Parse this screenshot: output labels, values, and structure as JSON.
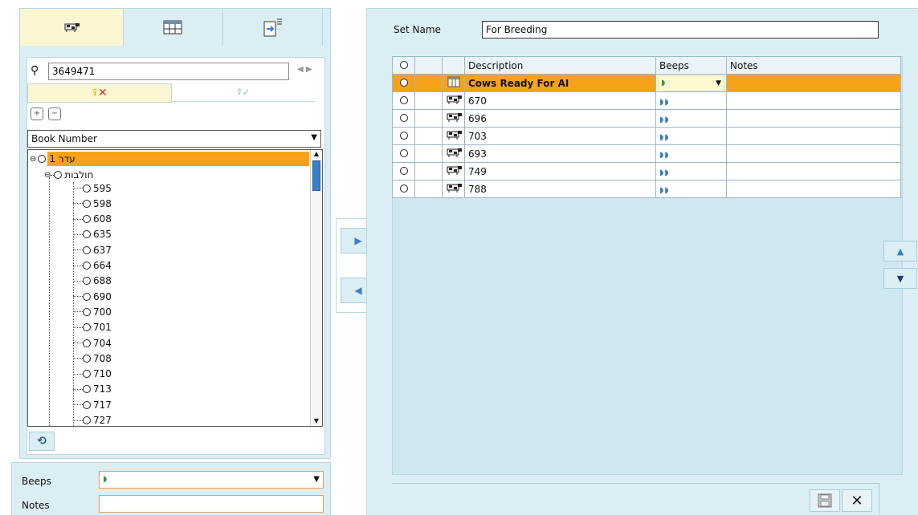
{
  "left": {
    "search_value": "3649471",
    "sort_by": "Book Number",
    "tree_root": "עדר 1",
    "tree_group": "חולבות",
    "tree_items": [
      "595",
      "598",
      "608",
      "635",
      "637",
      "664",
      "688",
      "690",
      "700",
      "701",
      "704",
      "708",
      "710",
      "713",
      "717",
      "727"
    ],
    "beeps_label": "Beeps",
    "notes_label": "Notes",
    "beeps_value": "",
    "notes_value": ""
  },
  "right": {
    "set_name_label": "Set Name",
    "set_name_value": "For Breeding",
    "columns": [
      "",
      "",
      "Description",
      "Beeps",
      "Notes"
    ],
    "rows": [
      {
        "description": "Cows Ready For AI",
        "beeps": "",
        "notes": "",
        "icon": "group-table-icon"
      },
      {
        "description": "670",
        "beeps": "",
        "notes": "",
        "icon": "cow-icon"
      },
      {
        "description": "696",
        "beeps": "",
        "notes": "",
        "icon": "cow-icon"
      },
      {
        "description": "703",
        "beeps": "",
        "notes": "",
        "icon": "cow-icon"
      },
      {
        "description": "693",
        "beeps": "",
        "notes": "",
        "icon": "cow-icon"
      },
      {
        "description": "749",
        "beeps": "",
        "notes": "",
        "icon": "cow-icon"
      },
      {
        "description": "788",
        "beeps": "",
        "notes": "",
        "icon": "cow-icon"
      }
    ]
  },
  "colors": {
    "panel_bg": "#dbeef3",
    "selected_row": "#f8a21a",
    "accent_blue": "#3b7fc4",
    "close_red": "#e0302a"
  }
}
